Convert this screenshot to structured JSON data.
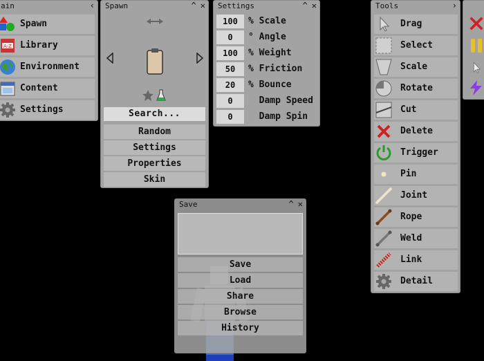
{
  "main_panel": {
    "title": "ain",
    "items": [
      {
        "label": "Spawn",
        "icon": "shapes-icon"
      },
      {
        "label": "Library",
        "icon": "library-icon"
      },
      {
        "label": "Environment",
        "icon": "globe-icon"
      },
      {
        "label": "Content",
        "icon": "calendar-icon"
      },
      {
        "label": "Settings",
        "icon": "gear-icon"
      }
    ]
  },
  "spawn_panel": {
    "title": "Spawn",
    "search_label": "Search...",
    "buttons": [
      "Random",
      "Settings",
      "Properties",
      "Skin"
    ]
  },
  "settings_panel": {
    "title": "Settings",
    "rows": [
      {
        "value": "100",
        "label": "% Scale"
      },
      {
        "value": "0",
        "label": "° Angle"
      },
      {
        "value": "100",
        "label": "% Weight"
      },
      {
        "value": "50",
        "label": "% Friction"
      },
      {
        "value": "20",
        "label": "% Bounce"
      },
      {
        "value": "0",
        "label": "  Damp Speed"
      },
      {
        "value": "0",
        "label": "  Damp Spin"
      }
    ]
  },
  "tools_panel": {
    "title": "Tools",
    "items": [
      {
        "label": "Drag",
        "icon": "cursor-icon"
      },
      {
        "label": "Select",
        "icon": "selection-icon"
      },
      {
        "label": "Scale",
        "icon": "scale-icon"
      },
      {
        "label": "Rotate",
        "icon": "rotate-icon"
      },
      {
        "label": "Cut",
        "icon": "cut-icon"
      },
      {
        "label": "Delete",
        "icon": "delete-icon"
      },
      {
        "label": "Trigger",
        "icon": "power-icon"
      },
      {
        "label": "Pin",
        "icon": "pin-icon"
      },
      {
        "label": "Joint",
        "icon": "joint-icon"
      },
      {
        "label": "Rope",
        "icon": "rope-icon"
      },
      {
        "label": "Weld",
        "icon": "weld-icon"
      },
      {
        "label": "Link",
        "icon": "link-icon"
      },
      {
        "label": "Detail",
        "icon": "gear-icon"
      }
    ]
  },
  "save_panel": {
    "title": "Save",
    "buttons": [
      "Save",
      "Load",
      "Share",
      "Browse",
      "History"
    ]
  },
  "colors": {
    "panel": "#a3a3a3",
    "row": "#b3b3b3",
    "background": "#000000"
  }
}
